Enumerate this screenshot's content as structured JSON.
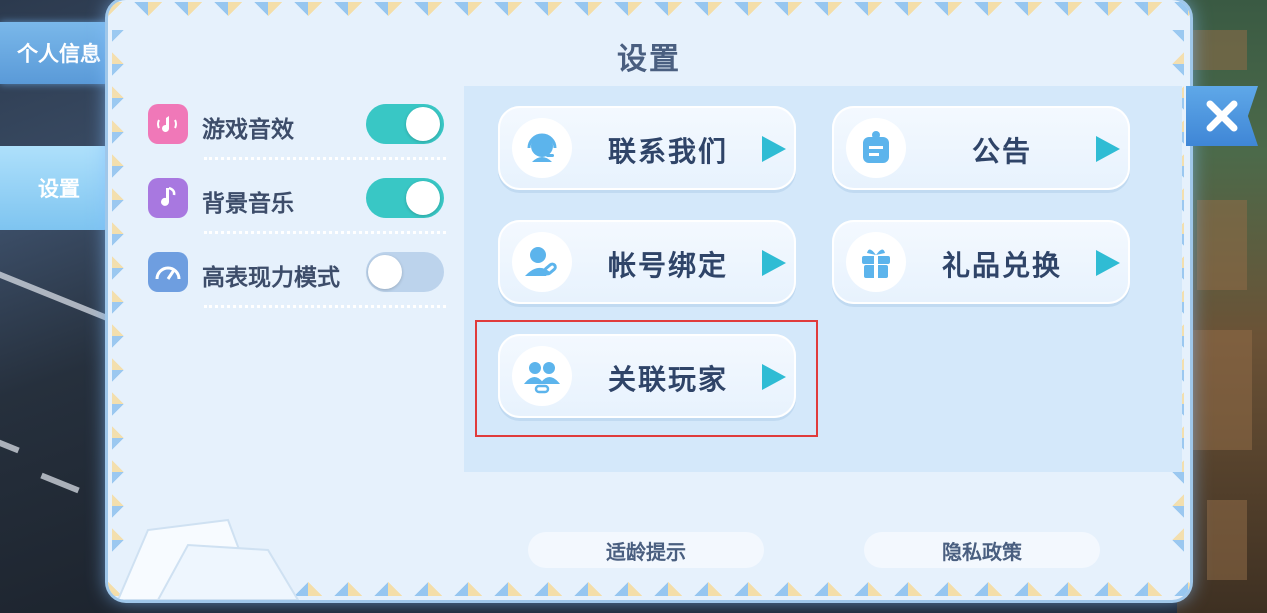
{
  "side_tabs": {
    "profile": "个人信息",
    "settings": "设置"
  },
  "title": "设置",
  "settings": [
    {
      "label": "游戏音效",
      "state": "on",
      "icon": "sound-icon",
      "icon_color": "#f078b8"
    },
    {
      "label": "背景音乐",
      "state": "on",
      "icon": "music-note-icon",
      "icon_color": "#a878e0"
    },
    {
      "label": "高表现力模式",
      "state": "off",
      "icon": "speedometer-icon",
      "icon_color": "#6e9ee0"
    }
  ],
  "buttons": [
    {
      "label": "联系我们",
      "icon": "headset-support-icon"
    },
    {
      "label": "公告",
      "icon": "notice-icon"
    },
    {
      "label": "帐号绑定",
      "icon": "account-link-icon"
    },
    {
      "label": "礼品兑换",
      "icon": "gift-icon"
    },
    {
      "label": "关联玩家",
      "icon": "linked-players-icon"
    }
  ],
  "footer": {
    "age_notice": "适龄提示",
    "privacy_policy": "隐私政策"
  },
  "colors": {
    "toggle_on": "#39c7c5",
    "toggle_off": "#bcd3ec",
    "arrow": "#2fbcd4",
    "title_text": "#4a5f80",
    "highlight_box": "#e03b3b"
  }
}
